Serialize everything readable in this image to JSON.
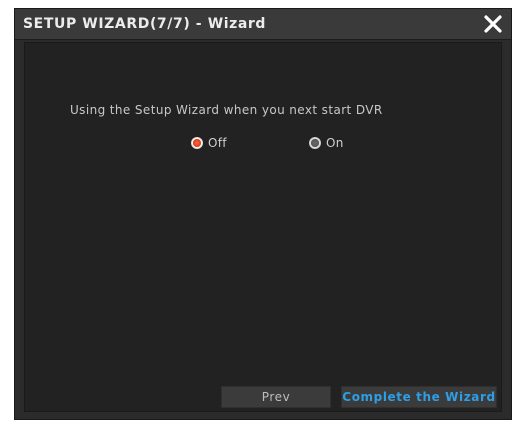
{
  "dialog": {
    "title": "SETUP WIZARD(7/7) - Wizard",
    "close_icon": "close-icon"
  },
  "content": {
    "message": "Using the Setup Wizard when you next start DVR",
    "options": [
      {
        "label": "Off",
        "selected": true
      },
      {
        "label": "On",
        "selected": false
      }
    ]
  },
  "buttons": {
    "prev_label": "Prev",
    "complete_label": "Complete the Wizard"
  },
  "colors": {
    "dialog_bg": "#2b2b2b",
    "content_bg": "#222222",
    "accent_blue": "#2d9fe6",
    "radio_selected": "#e3421c"
  }
}
